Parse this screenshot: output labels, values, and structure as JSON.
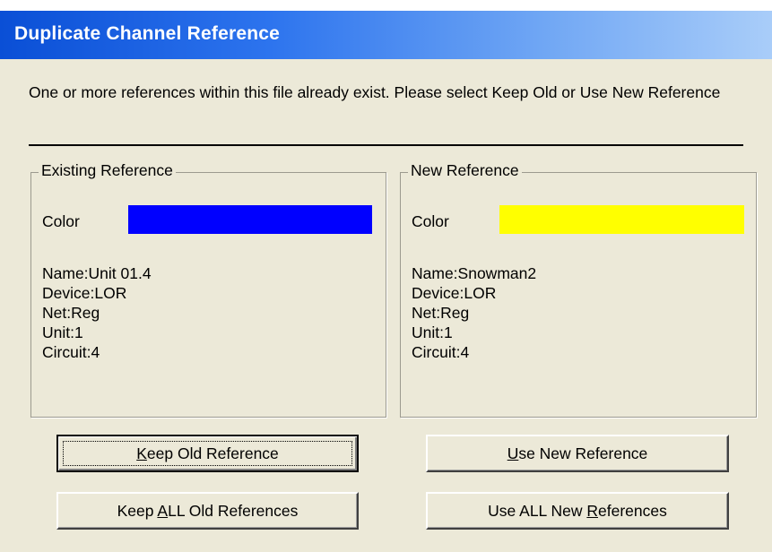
{
  "dialog": {
    "title": "Duplicate Channel Reference",
    "message": "One or more references within this file already exist.  Please select Keep Old or Use New Reference"
  },
  "existing": {
    "legend": "Existing Reference",
    "color_label": "Color",
    "color_value": "#0000ff",
    "name": "Name:Unit 01.4",
    "device": "Device:LOR",
    "net": "Net:Reg",
    "unit": "Unit:1",
    "circuit": "Circuit:4"
  },
  "new": {
    "legend": "New Reference",
    "color_label": "Color",
    "color_value": "#ffff00",
    "name": "Name:Snowman2",
    "device": "Device:LOR",
    "net": "Net:Reg",
    "unit": "Unit:1",
    "circuit": "Circuit:4"
  },
  "buttons": {
    "keep_old": {
      "before": "",
      "mnemonic": "K",
      "after": "eep Old Reference"
    },
    "use_new": {
      "before": "",
      "mnemonic": "U",
      "after": "se New Reference"
    },
    "keep_all": {
      "before": "Keep ",
      "mnemonic": "A",
      "after": "LL Old References"
    },
    "use_all": {
      "before": "Use ALL New ",
      "mnemonic": "R",
      "after": "eferences"
    }
  },
  "colors": {
    "title_gradient_start": "#0a4fd6",
    "title_gradient_end": "#a9cdf9",
    "dialog_background": "#ece9d8"
  }
}
